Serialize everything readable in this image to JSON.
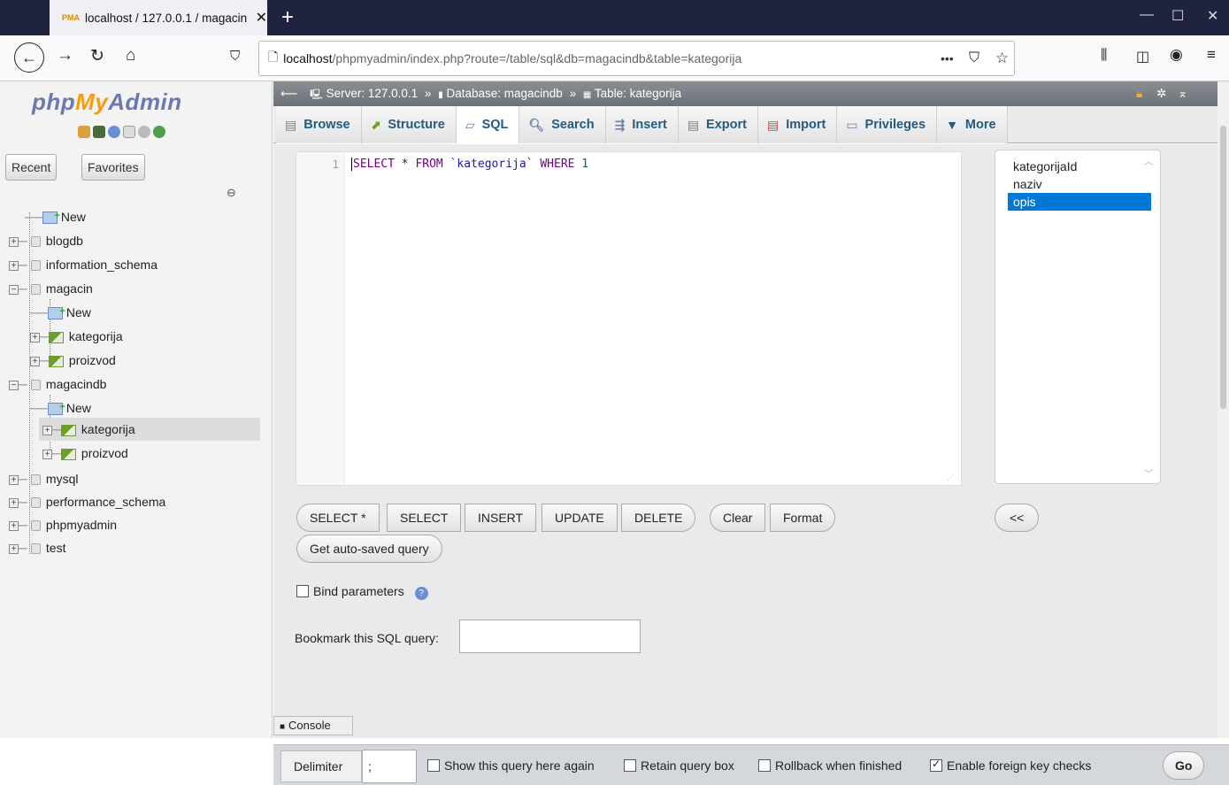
{
  "browser": {
    "tab_title": "localhost / 127.0.0.1 / magacin",
    "tab_close": "✕",
    "new_tab": "+",
    "url_host": "localhost",
    "url_path": "/phpmyadmin/index.php?route=/table/sql&db=magacindb&table=kategorija",
    "url_more": "•••",
    "minimize": "—",
    "maximize": "☐",
    "close": "✕"
  },
  "sidebar": {
    "logo_php": "php",
    "logo_my": "My",
    "logo_admin": "Admin",
    "recent": "Recent",
    "favorites": "Favorites",
    "tree": {
      "new_root": "New",
      "blogdb": "blogdb",
      "information_schema": "information_schema",
      "magacin": "magacin",
      "magacin_new": "New",
      "magacin_kategorija": "kategorija",
      "magacin_proizvod": "proizvod",
      "magacindb": "magacindb",
      "magacindb_new": "New",
      "magacindb_kategorija": "kategorija",
      "magacindb_proizvod": "proizvod",
      "mysql": "mysql",
      "performance_schema": "performance_schema",
      "phpmyadmin": "phpmyadmin",
      "test": "test"
    }
  },
  "breadcrumb": {
    "server": "Server: 127.0.0.1",
    "database": "Database: magacindb",
    "table": "Table: kategorija",
    "sep": "»"
  },
  "tabs": {
    "browse": "Browse",
    "structure": "Structure",
    "sql": "SQL",
    "search": "Search",
    "insert": "Insert",
    "export": "Export",
    "import": "Import",
    "privileges": "Privileges",
    "more": "More"
  },
  "editor": {
    "line_no": "1",
    "kw1": "SELECT",
    "star": " * ",
    "kw2": "FROM",
    "table": " `kategorija` ",
    "kw3": "WHERE",
    "num": " 1"
  },
  "columns": [
    "kategorijaId",
    "naziv",
    "opis"
  ],
  "buttons": {
    "select_star": "SELECT *",
    "select": "SELECT",
    "insert": "INSERT",
    "update": "UPDATE",
    "delete": "DELETE",
    "clear": "Clear",
    "format": "Format",
    "insert_col": "<<",
    "autosaved": "Get auto-saved query"
  },
  "bind_parameters": "Bind parameters",
  "bookmark_label": "Bookmark this SQL query:",
  "footer": {
    "delimiter_label": "Delimiter",
    "delimiter_value": ";",
    "show_again": "Show this query here again",
    "retain_box": "Retain query box",
    "rollback": "Rollback when finished",
    "foreign_keys": "Enable foreign key checks",
    "go": "Go",
    "console": "Console"
  },
  "checks": {
    "show_again": false,
    "retain_box": false,
    "rollback": false,
    "foreign_keys": true,
    "bind_parameters": false
  }
}
